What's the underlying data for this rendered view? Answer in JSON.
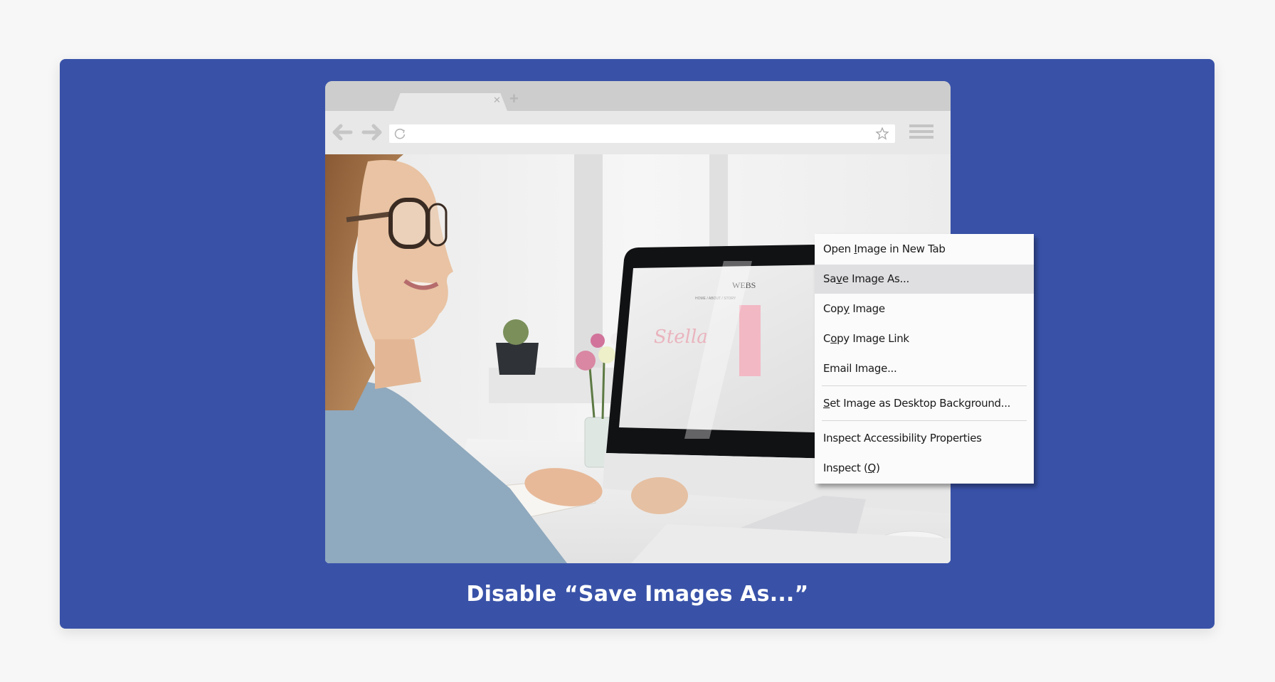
{
  "colors": {
    "page_background": "#f7f7f7",
    "panel_background": "#3952a8",
    "browser_tabbar": "#cdcdcd",
    "browser_toolbar": "#e8e8e8",
    "menu_background": "#fbfbfb",
    "menu_hover": "#dfdfe2",
    "caption_text": "#ffffff"
  },
  "browser": {
    "tab": {
      "title": "",
      "close_icon": "close-icon"
    },
    "new_tab_icon": "plus-icon",
    "address_bar": {
      "value": "",
      "reload_icon": "reload-icon",
      "bookmark_icon": "star-icon"
    },
    "nav": {
      "back_icon": "arrow-left-icon",
      "forward_icon": "arrow-right-icon"
    },
    "menu_icon": "hamburger-icon",
    "page": {
      "image_description": "Woman with glasses smiling at a desktop computer with flowers on desk",
      "monitor_site_title": "WEBS",
      "monitor_nav": "HOME / ABOUT / STORY"
    }
  },
  "context_menu": {
    "items": [
      {
        "pre": "Open ",
        "key": "I",
        "post": "mage in New Tab",
        "highlighted": false
      },
      {
        "pre": "Sa",
        "key": "v",
        "post": "e Image As...",
        "highlighted": true
      },
      {
        "pre": "Cop",
        "key": "y",
        "post": " Image",
        "highlighted": false
      },
      {
        "pre": "C",
        "key": "o",
        "post": "py Image Link",
        "highlighted": false
      },
      {
        "pre": "Email Ima",
        "key": "g",
        "post": "e...",
        "highlighted": false
      },
      {
        "pre": "",
        "key": "S",
        "post": "et Image as Desktop Background...",
        "highlighted": false
      },
      {
        "pre": "Inspect Accessibility Properties",
        "key": "",
        "post": "",
        "highlighted": false
      },
      {
        "pre": "Inspect (",
        "key": "Q",
        "post": ")",
        "highlighted": false
      }
    ]
  },
  "caption": "Disable “Save Images As...”"
}
